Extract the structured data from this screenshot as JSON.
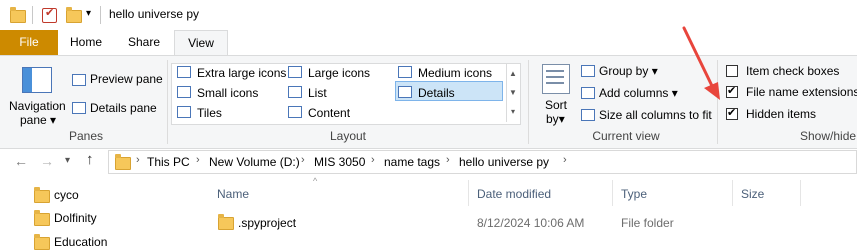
{
  "window": {
    "title": "hello universe py"
  },
  "tabs": {
    "file": "File",
    "home": "Home",
    "share": "Share",
    "view": "View"
  },
  "panes": {
    "navigation_pane_line1": "Navigation",
    "navigation_pane_line2": "pane",
    "preview_pane": "Preview pane",
    "details_pane": "Details pane",
    "label": "Panes"
  },
  "layout": {
    "items": [
      "Extra large icons",
      "Large icons",
      "Medium icons",
      "Small icons",
      "List",
      "Details",
      "Tiles",
      "Content"
    ],
    "selected": "Details",
    "label": "Layout"
  },
  "current_view": {
    "sort_line1": "Sort",
    "sort_line2": "by",
    "group_by": "Group by",
    "add_columns": "Add columns",
    "size_all_columns": "Size all columns to fit",
    "label": "Current view"
  },
  "show_hide": {
    "item_check_boxes": "Item check boxes",
    "item_check_boxes_checked": false,
    "file_name_extensions": "File name extensions",
    "file_name_extensions_checked": true,
    "hidden_items": "Hidden items",
    "hidden_items_checked": true,
    "label": "Show/hide"
  },
  "address": {
    "crumbs": [
      "This PC",
      "New Volume (D:)",
      "MIS 3050",
      "name tags",
      "hello universe py"
    ]
  },
  "sidebar": {
    "items": [
      "cyco",
      "Dolfinity",
      "Education"
    ]
  },
  "columns": {
    "name": "Name",
    "date": "Date modified",
    "type": "Type",
    "size": "Size"
  },
  "files": [
    {
      "name": ".spyproject",
      "date": "8/12/2024 10:06 AM",
      "type": "File folder",
      "size": ""
    }
  ],
  "colors": {
    "file_tab": "#cd8a00",
    "selection": "#cce4f7",
    "arrow": "#e8453c",
    "folder": "#f6c75a"
  }
}
